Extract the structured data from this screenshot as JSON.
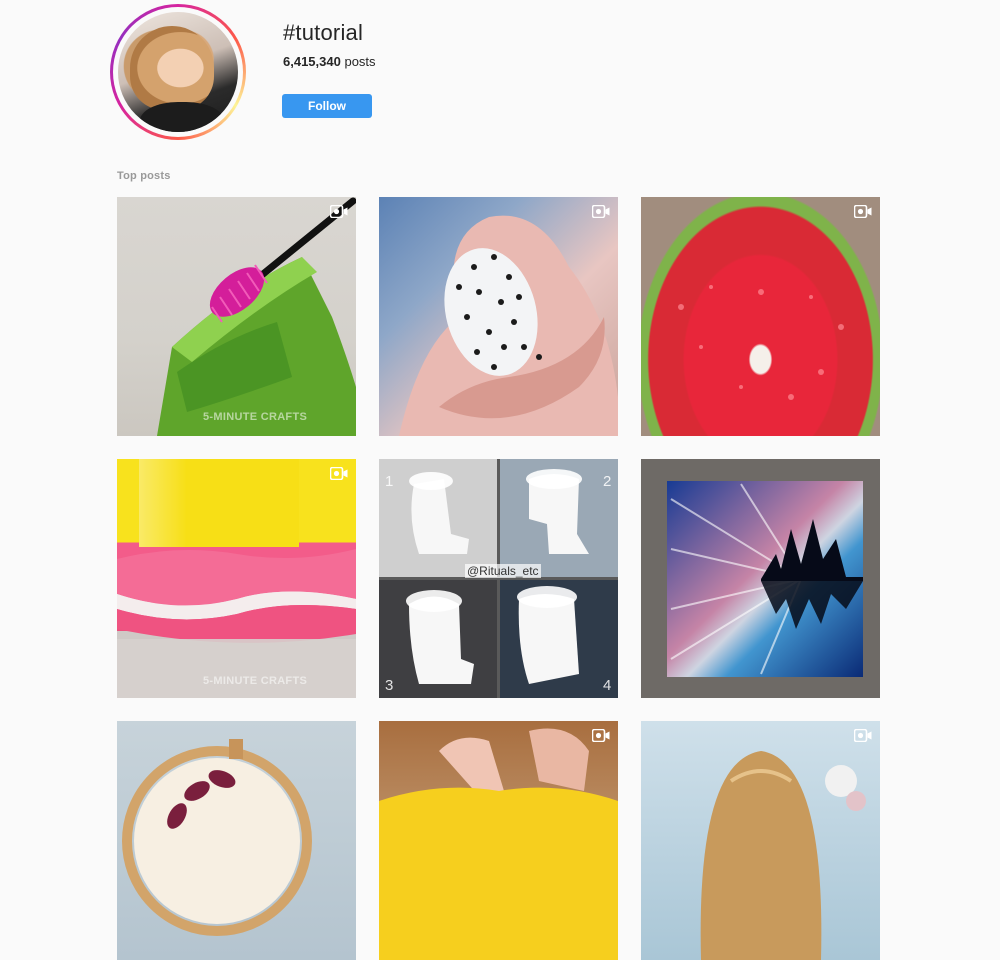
{
  "profile": {
    "hashtag": "#tutorial",
    "posts_count": "6,415,340",
    "posts_label": "posts",
    "follow_label": "Follow"
  },
  "top_posts": {
    "heading": "Top posts",
    "tiles": [
      {
        "kind": "video",
        "watermark": "5-MINUTE CRAFTS"
      },
      {
        "kind": "video"
      },
      {
        "kind": "video"
      },
      {
        "kind": "video",
        "watermark": "5-MINUTE CRAFTS"
      },
      {
        "kind": "carousel",
        "handle": "@Rituals_etc",
        "numbers": [
          "1",
          "2",
          "3",
          "4"
        ]
      },
      {
        "kind": "image"
      },
      {
        "kind": "image"
      },
      {
        "kind": "video"
      },
      {
        "kind": "video"
      }
    ]
  },
  "colors": {
    "accent": "#3897f0",
    "background": "#fafafa",
    "section_label": "#999999"
  },
  "icons": {
    "video": "video-camera-icon"
  }
}
